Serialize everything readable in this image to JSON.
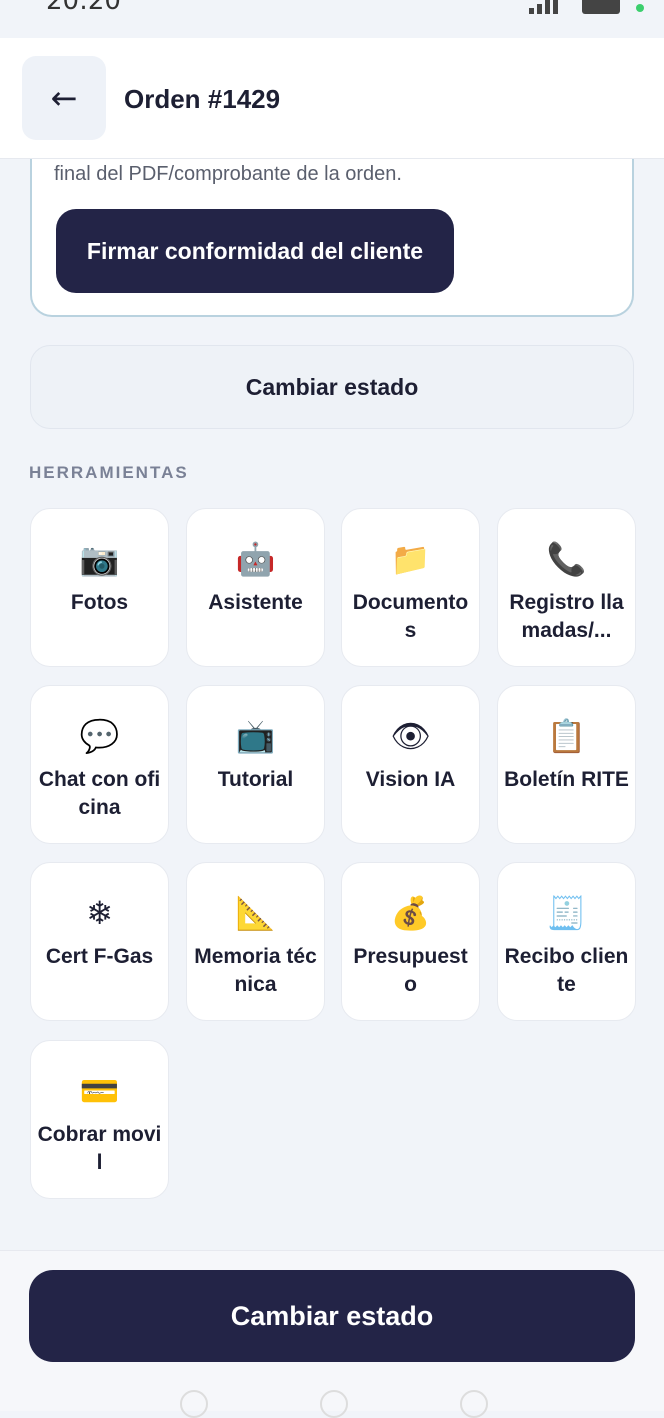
{
  "status_bar": {
    "time": "20:20"
  },
  "app_bar": {
    "back_icon": "←",
    "title": "Orden #1429"
  },
  "signature_card": {
    "text": "final del PDF/comprobante de la orden.",
    "button_label": "Firmar conformidad del cliente"
  },
  "state_button_label": "Cambiar estado",
  "tools_section": {
    "title": "HERRAMIENTAS",
    "items": [
      {
        "label": "Fotos",
        "icon": "📷",
        "icon_name": "camera-icon"
      },
      {
        "label": "Asistente",
        "icon": "🤖",
        "icon_name": "robot-icon"
      },
      {
        "label": "Documentos",
        "icon": "📁",
        "icon_name": "folder-icon"
      },
      {
        "label": "Registro llamadas/...",
        "icon": "📞",
        "icon_name": "phone-icon"
      },
      {
        "label": "Chat con oficina",
        "icon": "💬",
        "icon_name": "chat-icon"
      },
      {
        "label": "Tutorial",
        "icon": "📺",
        "icon_name": "tv-icon"
      },
      {
        "label": "Vision IA",
        "icon": "👁",
        "icon_name": "eye-icon"
      },
      {
        "label": "Boletín RITE",
        "icon": "📋",
        "icon_name": "clipboard-icon"
      },
      {
        "label": "Cert F-Gas",
        "icon": "❄",
        "icon_name": "snowflake-icon"
      },
      {
        "label": "Memoria técnica",
        "icon": "📐",
        "icon_name": "ruler-triangle-icon"
      },
      {
        "label": "Presupuesto",
        "icon": "💰",
        "icon_name": "money-bag-icon"
      },
      {
        "label": "Recibo cliente",
        "icon": "🧾",
        "icon_name": "receipt-icon"
      },
      {
        "label": "Cobrar movil",
        "icon": "💳",
        "icon_name": "credit-card-icon"
      }
    ]
  },
  "bottom_button_label": "Cambiar estado"
}
